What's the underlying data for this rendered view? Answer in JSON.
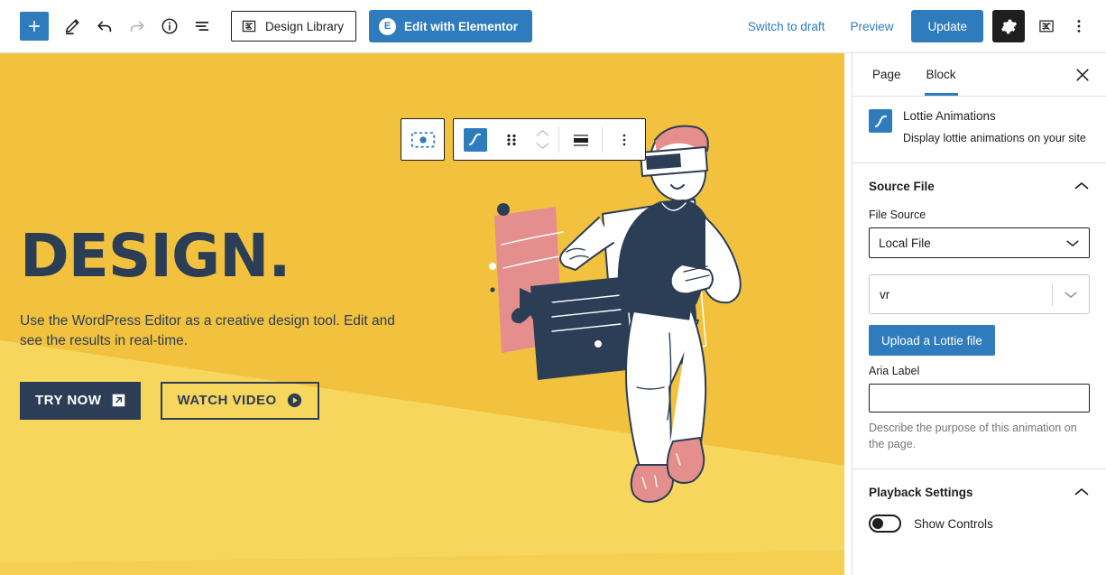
{
  "topbar": {
    "add_label": "+",
    "tools": [
      {
        "name": "edit-pencil-icon",
        "label": "Edit"
      },
      {
        "name": "undo-icon",
        "label": "Undo"
      },
      {
        "name": "redo-icon",
        "label": "Redo"
      },
      {
        "name": "info-icon",
        "label": "Details"
      },
      {
        "name": "list-view-icon",
        "label": "List View"
      }
    ],
    "design_library_label": "Design Library",
    "elementor_label": "Edit with Elementor",
    "elementor_badge": "E",
    "switch_to_draft_label": "Switch to draft",
    "preview_label": "Preview",
    "update_label": "Update",
    "gear_label": "Settings",
    "elementor_icon_label": "Elementor",
    "more_label": "Options"
  },
  "block_toolbar": {
    "select_parent_label": "Select parent block",
    "block_type_label": "Lottie Animations block",
    "drag_label": "Drag",
    "move_up_label": "Move up",
    "move_down_label": "Move down",
    "align_label": "Align",
    "more_label": "Options"
  },
  "canvas": {
    "title": "DESIGN.",
    "subtitle": "Use the WordPress Editor as a creative design tool. Edit and see the results in real-time.",
    "primary_button": "TRY NOW",
    "secondary_button": "WATCH VIDEO",
    "primary_icon": "external-link-icon",
    "secondary_icon": "play-circle-icon",
    "illustration_name": "vr-headset-person-illustration",
    "bg_color_light": "#f7d65d",
    "bg_color_dark": "#f2c23e",
    "text_color": "#2c3e55"
  },
  "sidebar": {
    "tabs": [
      {
        "label": "Page",
        "active": false
      },
      {
        "label": "Block",
        "active": true
      }
    ],
    "close_label": "Close settings",
    "block_card": {
      "title": "Lottie Animations",
      "description": "Display lottie animations on your site",
      "icon": "lottie-curve-icon"
    },
    "source_file": {
      "section_title": "Source File",
      "file_source_label": "File Source",
      "file_source_value": "Local File",
      "file_picker_value": "vr",
      "upload_label": "Upload a Lottie file",
      "aria_label_label": "Aria Label",
      "aria_label_value": "",
      "aria_label_placeholder": "",
      "aria_help": "Describe the purpose of this animation on the page."
    },
    "playback": {
      "section_title": "Playback Settings",
      "show_controls_label": "Show Controls",
      "show_controls_on": false
    }
  },
  "colors": {
    "accent": "#2e7bbd",
    "dark": "#1e1e1e"
  }
}
